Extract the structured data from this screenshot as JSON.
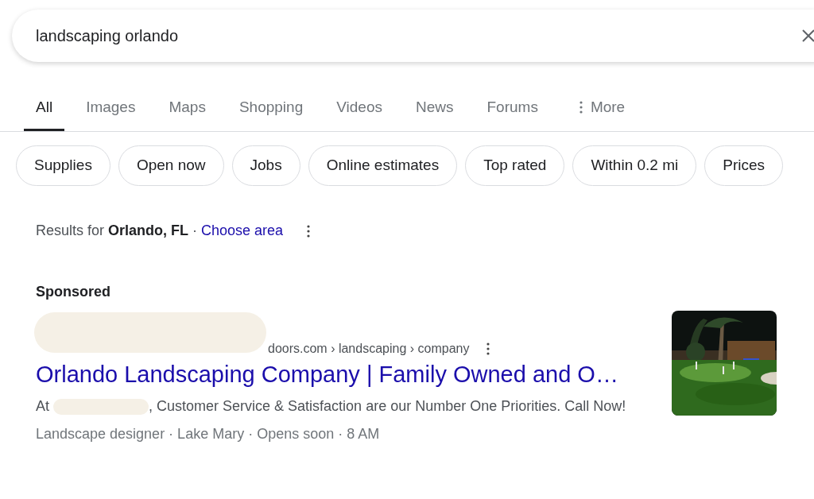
{
  "search": {
    "value": "landscaping orlando"
  },
  "tabs": [
    {
      "label": "All",
      "selected": true,
      "kind": "tab"
    },
    {
      "label": "Images",
      "selected": false,
      "kind": "tab"
    },
    {
      "label": "Maps",
      "selected": false,
      "kind": "tab"
    },
    {
      "label": "Shopping",
      "selected": false,
      "kind": "tab"
    },
    {
      "label": "Videos",
      "selected": false,
      "kind": "tab"
    },
    {
      "label": "News",
      "selected": false,
      "kind": "tab"
    },
    {
      "label": "Forums",
      "selected": false,
      "kind": "tab"
    },
    {
      "label": "More",
      "selected": false,
      "kind": "menu"
    }
  ],
  "chips": [
    "Supplies",
    "Open now",
    "Jobs",
    "Online estimates",
    "Top rated",
    "Within 0.2 mi",
    "Prices"
  ],
  "location": {
    "prefix": "Results for",
    "place": "Orlando, FL",
    "separator": "·",
    "link": "Choose area"
  },
  "sponsored_label": "Sponsored",
  "ad": {
    "url": "doors.com › landscaping › company",
    "title": "Orlando Landscaping Company | Family Owned and O…",
    "description_start": "At",
    "description_rest": ", Customer Service & Satisfaction are our Number One Priorities. Call Now!",
    "meta": "Landscape designer · Lake Mary · Opens soon · 8 AM"
  }
}
